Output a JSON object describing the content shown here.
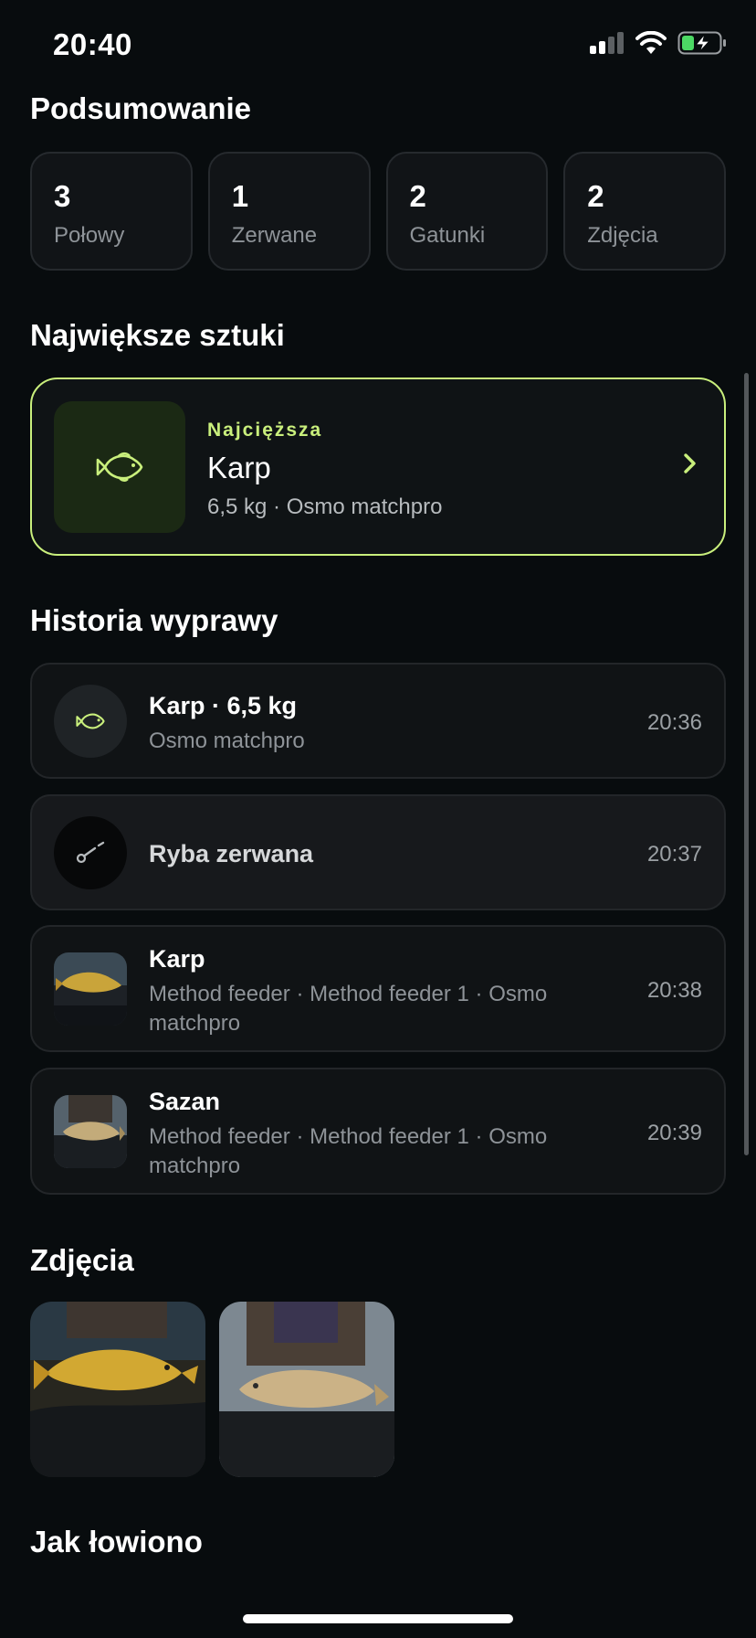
{
  "status_bar": {
    "time": "20:40"
  },
  "summary": {
    "title": "Podsumowanie",
    "stats": [
      {
        "value": "3",
        "label": "Połowy"
      },
      {
        "value": "1",
        "label": "Zerwane"
      },
      {
        "value": "2",
        "label": "Gatunki"
      },
      {
        "value": "2",
        "label": "Zdjęcia"
      }
    ]
  },
  "biggest": {
    "title": "Największe sztuki",
    "badge": "Najcięższa",
    "name": "Karp",
    "meta": "6,5 kg · Osmo matchpro",
    "icon": "fish-icon"
  },
  "history": {
    "title": "Historia wyprawy",
    "items": [
      {
        "title": "Karp · 6,5 kg",
        "subtitle": "Osmo matchpro",
        "time": "20:36",
        "icon": "fish-icon"
      },
      {
        "title": "Ryba zerwana",
        "time": "20:37",
        "icon": "hook-icon"
      },
      {
        "title": "Karp",
        "subtitle": "Method feeder · Method feeder 1 · Osmo matchpro",
        "time": "20:38",
        "icon": "photo-thumbnail"
      },
      {
        "title": "Sazan",
        "subtitle": "Method feeder · Method feeder 1 · Osmo matchpro",
        "time": "20:39",
        "icon": "photo-thumbnail"
      }
    ]
  },
  "photos": {
    "title": "Zdjęcia"
  },
  "how_caught": {
    "title": "Jak łowiono"
  },
  "colors": {
    "accent": "#c9ef7c",
    "background": "#080c0e",
    "card": "#111417"
  }
}
